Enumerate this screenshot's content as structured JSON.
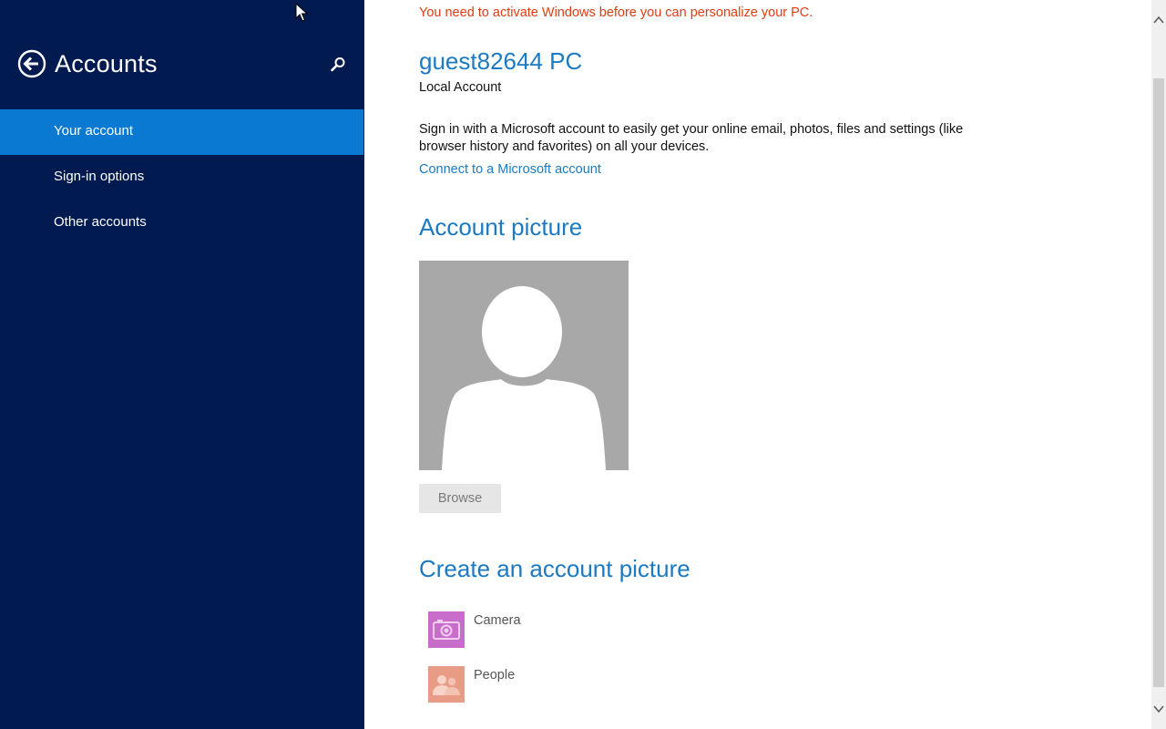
{
  "sidebar": {
    "title": "Accounts",
    "back_icon": "back-arrow-circle-icon",
    "search_icon": "search-icon",
    "items": [
      {
        "label": "Your account",
        "selected": true
      },
      {
        "label": "Sign-in options",
        "selected": false
      },
      {
        "label": "Other accounts",
        "selected": false
      }
    ]
  },
  "main": {
    "activation_warning": "You need to activate Windows before you can personalize your PC.",
    "pc_name": "guest82644 PC",
    "account_type": "Local Account",
    "signin_description": "Sign in with a Microsoft account to easily get your online email, photos, files and settings (like browser history and favorites) on all your devices.",
    "connect_link": "Connect to a Microsoft account",
    "account_picture_section": {
      "title": "Account picture",
      "browse_label": "Browse"
    },
    "create_section": {
      "title": "Create an account picture",
      "items": [
        {
          "label": "Camera",
          "icon": "camera-icon",
          "tile_color": "#c86dc9"
        },
        {
          "label": "People",
          "icon": "people-icon",
          "tile_color": "#e89b85"
        }
      ]
    }
  },
  "colors": {
    "sidebar_bg": "#011a4f",
    "selected_item": "#0a79d1",
    "accent": "#1b7ac2",
    "warning": "#e03c11"
  }
}
